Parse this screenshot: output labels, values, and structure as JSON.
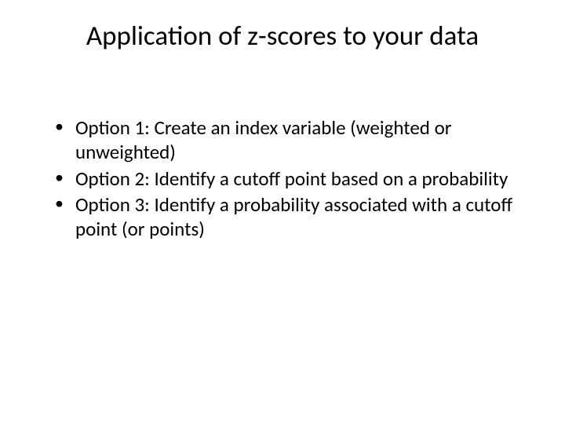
{
  "slide": {
    "title": "Application of z-scores to your data",
    "bullets": [
      "Option 1: Create an index variable (weighted or unweighted)",
      "Option 2: Identify a cutoff point based on a probability",
      "Option 3: Identify a probability associated with a cutoff point (or points)"
    ]
  }
}
